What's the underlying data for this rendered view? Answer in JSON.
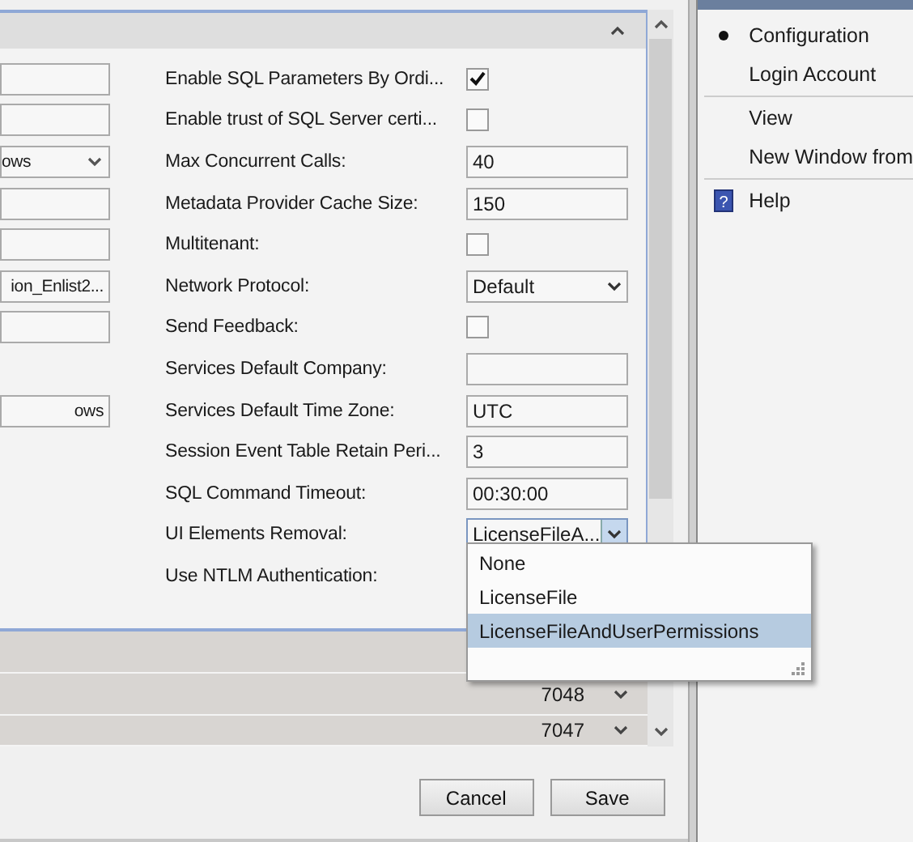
{
  "rows": [
    {
      "left": {
        "kind": "field"
      },
      "label": "Enable SQL Parameters By Ordi...",
      "control": {
        "kind": "checkbox",
        "checked": true
      }
    },
    {
      "left": {
        "kind": "field"
      },
      "label": "Enable trust of SQL Server certi...",
      "control": {
        "kind": "checkbox",
        "checked": false
      }
    },
    {
      "left": {
        "kind": "dropdown",
        "value": "ows"
      },
      "label": "Max Concurrent Calls:",
      "control": {
        "kind": "field",
        "value": "40"
      }
    },
    {
      "left": {
        "kind": "field"
      },
      "label": "Metadata Provider Cache Size:",
      "control": {
        "kind": "field",
        "value": "150"
      }
    },
    {
      "left": {
        "kind": "field"
      },
      "label": "Multitenant:",
      "control": {
        "kind": "checkbox",
        "checked": false
      }
    },
    {
      "left": {
        "kind": "field",
        "value": "ion_Enlist2..."
      },
      "label": "Network Protocol:",
      "control": {
        "kind": "dropdown",
        "value": "Default"
      }
    },
    {
      "left": {
        "kind": "field"
      },
      "label": "Send Feedback:",
      "control": {
        "kind": "checkbox",
        "checked": false
      }
    },
    {
      "left": {
        "kind": "none"
      },
      "label": "Services Default Company:",
      "control": {
        "kind": "field"
      }
    },
    {
      "left": {
        "kind": "field",
        "value": "ows"
      },
      "label": "Services Default Time Zone:",
      "control": {
        "kind": "field",
        "value": "UTC"
      }
    },
    {
      "left": {
        "kind": "none"
      },
      "label": "Session Event Table Retain Peri...",
      "control": {
        "kind": "field",
        "value": "3"
      }
    },
    {
      "left": {
        "kind": "none"
      },
      "label": "SQL Command Timeout:",
      "control": {
        "kind": "field",
        "value": "00:30:00"
      }
    },
    {
      "left": {
        "kind": "none"
      },
      "label": "UI Elements Removal:",
      "control": {
        "kind": "dropdown",
        "value": "LicenseFileA...",
        "expanded": true
      }
    },
    {
      "left": {
        "kind": "none"
      },
      "label": "Use NTLM Authentication:",
      "control": {
        "kind": "none"
      }
    }
  ],
  "dropdown_options": [
    {
      "label": "None",
      "selected": false
    },
    {
      "label": "LicenseFile",
      "selected": false
    },
    {
      "label": "LicenseFileAndUserPermissions",
      "selected": true
    }
  ],
  "list_rows": [
    {
      "kind": "blank"
    },
    {
      "kind": "value",
      "value": "7048"
    },
    {
      "kind": "value",
      "value": "7047"
    }
  ],
  "buttons": [
    "Cancel",
    "Save"
  ],
  "menu": [
    {
      "kind": "item",
      "label": "Configuration",
      "selected": true
    },
    {
      "kind": "item",
      "label": "Login Account",
      "selected": false
    },
    {
      "kind": "separator"
    },
    {
      "kind": "item",
      "label": "View",
      "selected": false
    },
    {
      "kind": "item",
      "label": "New Window from",
      "selected": false
    },
    {
      "kind": "separator"
    },
    {
      "kind": "help",
      "label": "Help",
      "icon_text": "?"
    }
  ]
}
